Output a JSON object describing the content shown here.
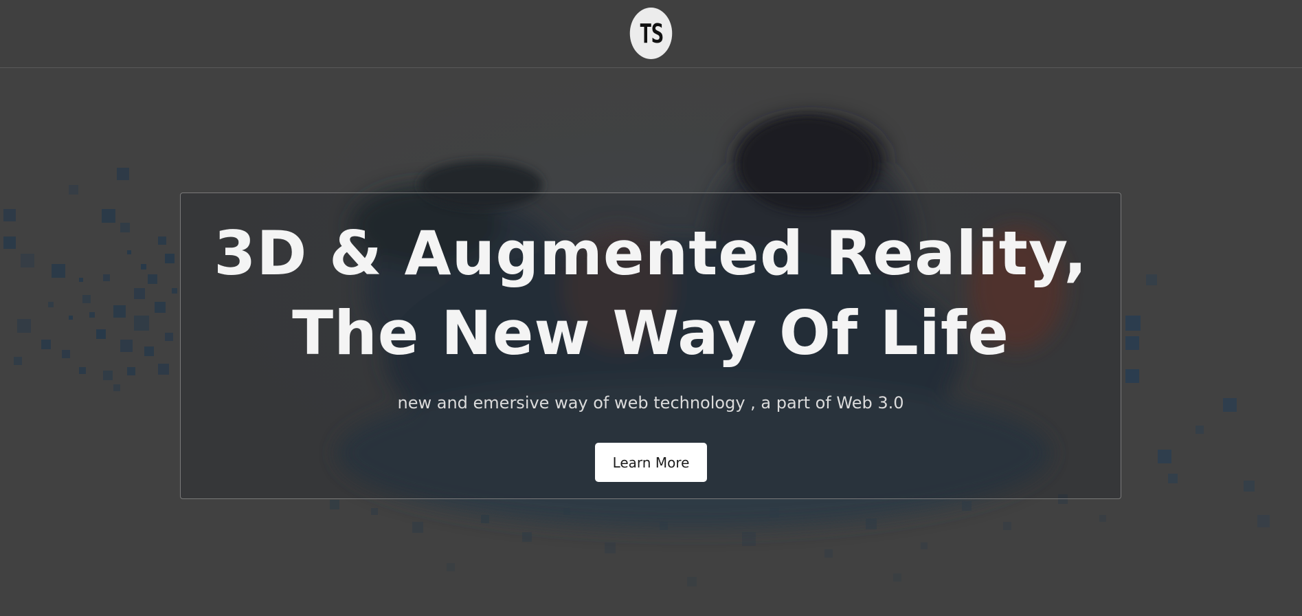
{
  "header": {
    "logo_text": "TS"
  },
  "hero": {
    "title_line1": "3D & Augmented Reality,",
    "title_line2": "The New Way Of Life",
    "subtitle": "new and emersive way of web technology , a part of Web 3.0",
    "cta_label": "Learn More"
  },
  "colors": {
    "background": "#414141",
    "button_bg": "#ffffff",
    "title_text": "#f4f4f4"
  }
}
